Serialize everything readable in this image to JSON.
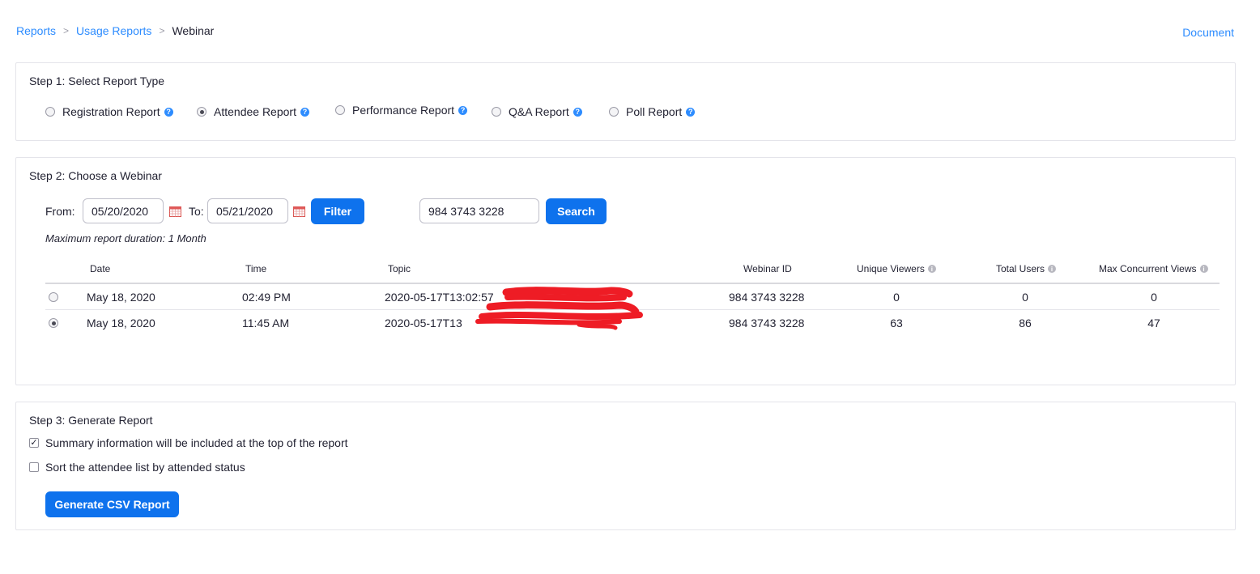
{
  "breadcrumb": {
    "items": [
      "Reports",
      "Usage Reports",
      "Webinar"
    ],
    "separator": ">"
  },
  "header": {
    "document_link": "Document"
  },
  "step1": {
    "title": "Step 1: Select Report Type",
    "options": [
      {
        "label": "Registration Report",
        "checked": false
      },
      {
        "label": "Attendee Report",
        "checked": true
      },
      {
        "label": "Performance Report",
        "checked": false
      },
      {
        "label": "Q&A Report",
        "checked": false
      },
      {
        "label": "Poll Report",
        "checked": false
      }
    ]
  },
  "step2": {
    "title": "Step 2: Choose a Webinar",
    "from_label": "From:",
    "from_value": "05/20/2020",
    "to_label": "To:",
    "to_value": "05/21/2020",
    "filter_button": "Filter",
    "search_value": "984 3743 3228",
    "search_button": "Search",
    "note": "Maximum report duration: 1 Month",
    "table": {
      "headers": [
        "Date",
        "Time",
        "Topic",
        "Webinar ID",
        "Unique Viewers",
        "Total Users",
        "Max Concurrent Views"
      ],
      "rows": [
        {
          "selected": false,
          "date": "May 18, 2020",
          "time": "02:49 PM",
          "topic": "2020-05-17T13:02:57",
          "webinar_id": "984 3743 3228",
          "unique_viewers": "0",
          "total_users": "0",
          "max_concurrent": "0"
        },
        {
          "selected": true,
          "date": "May 18, 2020",
          "time": "11:45 AM",
          "topic": "2020-05-17T13",
          "webinar_id": "984 3743 3228",
          "unique_viewers": "63",
          "total_users": "86",
          "max_concurrent": "47"
        }
      ]
    }
  },
  "step3": {
    "title": "Step 3: Generate Report",
    "options": [
      {
        "label": "Summary information will be included at the top of the report",
        "checked": true
      },
      {
        "label": "Sort the attendee list by attended status",
        "checked": false
      }
    ],
    "generate_button": "Generate CSV Report"
  },
  "colors": {
    "accent": "#0e72ed",
    "link": "#2d8cff",
    "redaction": "#ee1c25"
  },
  "icons": {
    "help": "question-circle-icon",
    "info": "info-circle-icon",
    "calendar": "calendar-icon"
  }
}
